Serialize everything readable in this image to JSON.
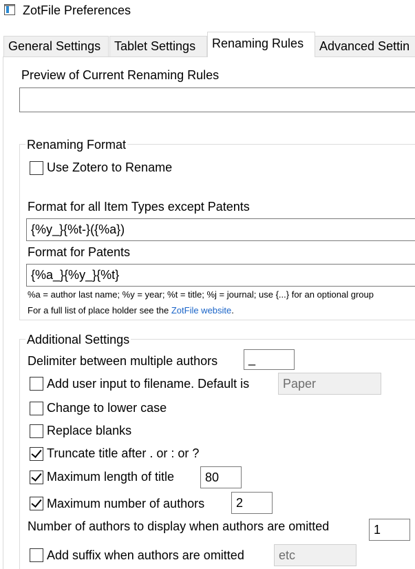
{
  "window": {
    "title": "ZotFile Preferences"
  },
  "tabs": [
    {
      "label": "General Settings"
    },
    {
      "label": "Tablet Settings"
    },
    {
      "label": "Renaming Rules"
    },
    {
      "label": "Advanced Settin"
    }
  ],
  "preview": {
    "label": "Preview of Current Renaming Rules",
    "value": ""
  },
  "renaming_format": {
    "title": "Renaming Format",
    "use_zotero_label": "Use Zotero to Rename",
    "use_zotero_checked": false,
    "format_all_label": "Format for all Item Types except Patents",
    "format_all_value": "{%y_}{%t-}({%a})",
    "format_patents_label": "Format for Patents",
    "format_patents_value": "{%a_}{%y_}{%t}",
    "help_line1": "%a = author last name; %y = year; %t = title; %j = journal; use {...} for an optional group",
    "help_line2_prefix": "For a full list of place holder see the ",
    "help_link": "ZotFile website",
    "help_line2_suffix": "."
  },
  "additional": {
    "title": "Additional Settings",
    "delimiter_label": "Delimiter between multiple authors",
    "delimiter_value": "_",
    "user_input_label": "Add user input to filename. Default is",
    "user_input_checked": false,
    "user_input_value": "Paper",
    "lower_case_label": "Change to lower case",
    "lower_case_checked": false,
    "replace_blanks_label": "Replace blanks",
    "replace_blanks_checked": false,
    "truncate_label": "Truncate title after . or : or ?",
    "truncate_checked": true,
    "max_title_label": "Maximum length of title",
    "max_title_checked": true,
    "max_title_value": "80",
    "max_authors_label": "Maximum number of authors",
    "max_authors_checked": true,
    "max_authors_value": "2",
    "num_display_label": "Number of authors to display when authors are omitted",
    "num_display_value": "1",
    "suffix_label": "Add suffix when authors are omitted",
    "suffix_checked": false,
    "suffix_value": "etc"
  }
}
